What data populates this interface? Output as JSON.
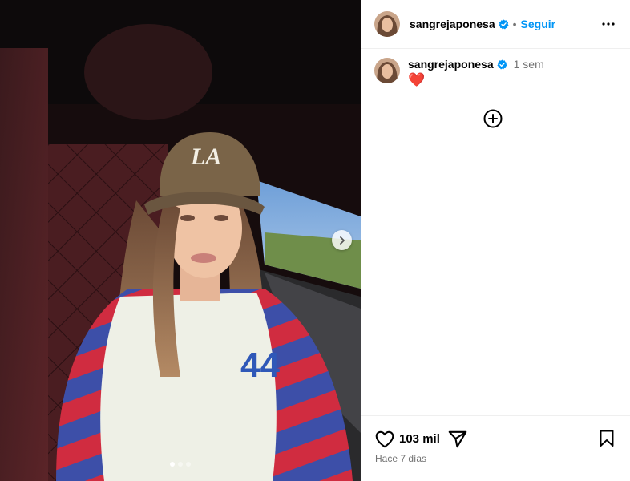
{
  "author": {
    "username": "sangrejaponesa",
    "verified_icon": "verified-badge-icon",
    "follow_label": "Seguir",
    "separator": "•"
  },
  "comment": {
    "username": "sangrejaponesa",
    "time": "1 sem",
    "caption": "❤️"
  },
  "icons": {
    "more": "more-options-icon",
    "load_more": "add-circle-icon",
    "like": "heart-icon",
    "share": "share-icon",
    "save": "bookmark-icon",
    "next": "chevron-right-icon"
  },
  "actions": {
    "likes": "103 mil",
    "date": "Hace 7 días"
  },
  "carousel": {
    "slides": 3,
    "current": 1
  },
  "colors": {
    "accent": "#0095f6",
    "verified": "#0095f6",
    "muted_text": "#737373"
  }
}
